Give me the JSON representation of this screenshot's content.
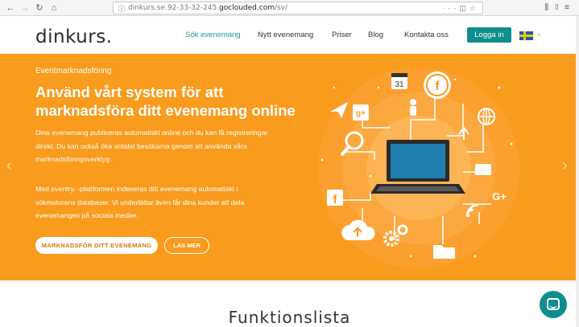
{
  "browser": {
    "url_prefix": "dinkurs.se.92-33-32-245.",
    "url_domain": "goclouded.com",
    "url_path": "/sv/",
    "nav_icons": [
      "back-icon",
      "forward-icon",
      "reload-icon",
      "home-icon"
    ]
  },
  "header": {
    "logo": "dinkurs.",
    "nav": [
      "Sök evenemang",
      "Nytt evenemang",
      "Priser",
      "Blog",
      "Kontakta oss"
    ],
    "active_nav": "Sök evenemang",
    "login_label": "Logga in",
    "language": "sv"
  },
  "hero": {
    "eyebrow": "Eventmarknadsföring",
    "title": "Använd vårt system för att marknadsföra ditt evenemang online",
    "p1": "Dina evenemang publiceras automatiskt online och du kan få registreringar direkt. Du kan också öka antalet besökarna genom att använda våra marknadsföringsverktyg.",
    "p2": "Med eventry. -plattformen indexeras ditt evenemang automatiskt i sökmotorens databaser. Vi underlättar även får dina kunder att dela evenemangen på sociala medier.",
    "primary_button": "MARKNADSFÖR DITT EVENEMANG",
    "secondary_button": "LÄS MER",
    "calendar_day": "31",
    "colors": {
      "background": "#f99b1c",
      "accent": "#0f8e8e"
    }
  },
  "section": {
    "title": "Funktionslista"
  }
}
